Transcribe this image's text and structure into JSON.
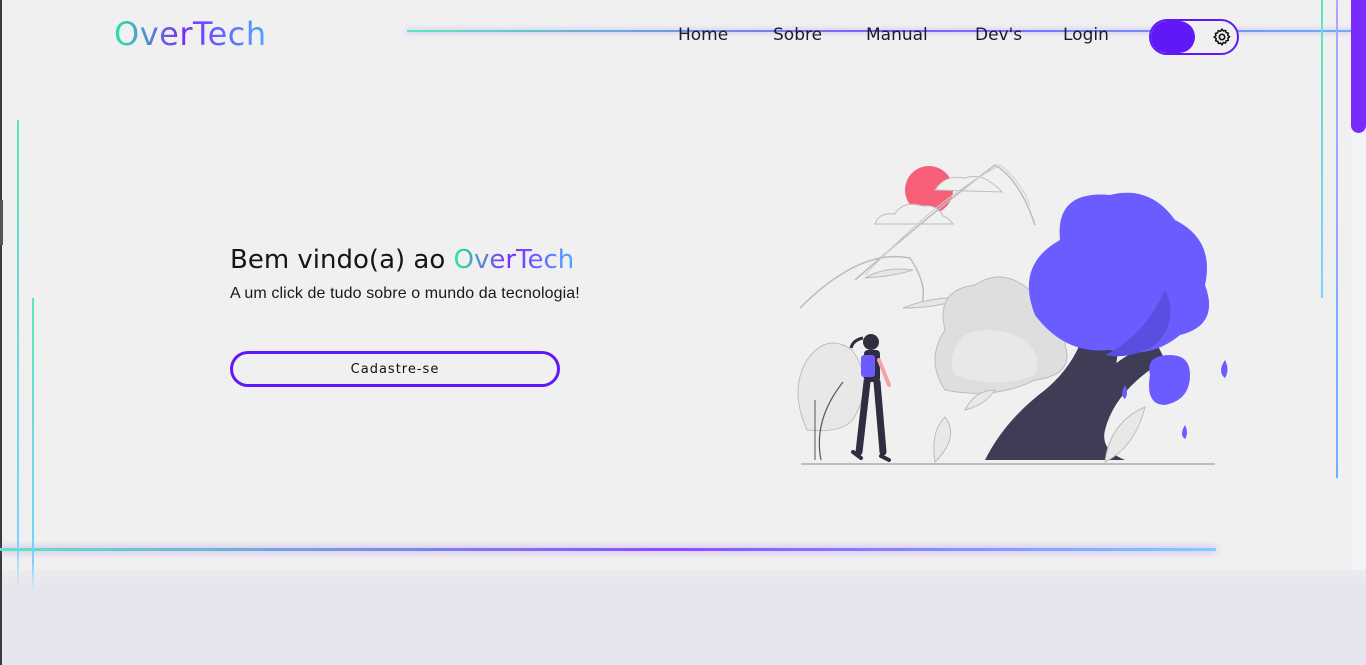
{
  "brand": {
    "name": "OverTech"
  },
  "nav": {
    "items": [
      {
        "label": "Home"
      },
      {
        "label": "Sobre"
      },
      {
        "label": "Manual"
      },
      {
        "label": "Dev's"
      },
      {
        "label": "Login"
      }
    ]
  },
  "theme_toggle": {
    "icon": "gear-icon",
    "state": "on"
  },
  "hero": {
    "welcome_prefix": "Bem vindo(a) ao",
    "welcome_brand": "OverTech",
    "subtitle": "A um click de tudo sobre o mundo da tecnologia!",
    "cta_label": "Cadastre-se"
  },
  "colors": {
    "accent": "#6018f6",
    "gradient_start": "#2ee6a6",
    "gradient_mid": "#7a2cff",
    "gradient_end": "#4aa8ff",
    "tree": "#6a5cff",
    "sun": "#f8607a",
    "trunk": "#3f3d56"
  }
}
